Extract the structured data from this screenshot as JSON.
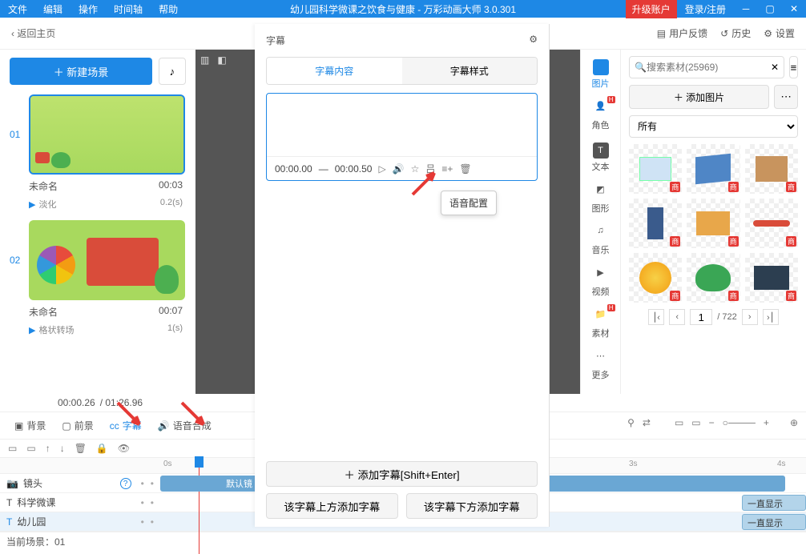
{
  "menubar": {
    "items": [
      "文件",
      "编辑",
      "操作",
      "时间轴",
      "帮助"
    ],
    "title": "幼儿园科学微课之饮食与健康 - 万彩动画大师 3.0.301",
    "upgrade": "升级账户",
    "login": "登录/注册"
  },
  "topbar": {
    "back": "‹ 返回主页",
    "feedback": "用户反馈",
    "history": "历史",
    "settings": "设置"
  },
  "left": {
    "new_scene": "＋ 新建场景",
    "scenes": [
      {
        "num": "01",
        "name": "未命名",
        "dur": "00:03",
        "trans": "淡化",
        "trans_dur": "0.2(s)"
      },
      {
        "num": "02",
        "name": "未命名",
        "dur": "00:07",
        "trans": "格状转场",
        "trans_dur": "1(s)"
      }
    ]
  },
  "timecode": {
    "cur": "00:00.26",
    "total": "/ 01:26.96"
  },
  "tabs": {
    "bg": "背景",
    "fg": "前景",
    "subtitle": "字幕",
    "tts": "语音合成"
  },
  "zoom": {
    "plus": "+"
  },
  "ruler": {
    "m0": "0s",
    "m3": "3s",
    "m4": "4s"
  },
  "tracks": {
    "lens": "镜头",
    "course": "科学微课",
    "kinder": "幼儿园",
    "default_lens": "默认镜",
    "always_show": "一直显示"
  },
  "footer": {
    "scene": "当前场景：01"
  },
  "rail": {
    "image": "图片",
    "role": "角色",
    "text": "文本",
    "shape": "图形",
    "music": "音乐",
    "video": "视频",
    "asset": "素材",
    "more": "更多"
  },
  "assets": {
    "search_placeholder": "搜索素材(25969)",
    "add_image": "＋ 添加图片",
    "category": "所有",
    "badge": "商",
    "page": "1",
    "total_pages": "/ 722"
  },
  "subtitle": {
    "title": "字幕",
    "tabs": {
      "content": "字幕内容",
      "style": "字幕样式"
    },
    "start": "00:00.00",
    "dash": "—",
    "end": "00:00.50",
    "tooltip": "语音配置",
    "add": "＋ 添加字幕[Shift+Enter]",
    "add_above": "该字幕上方添加字幕",
    "add_below": "该字幕下方添加字幕"
  }
}
